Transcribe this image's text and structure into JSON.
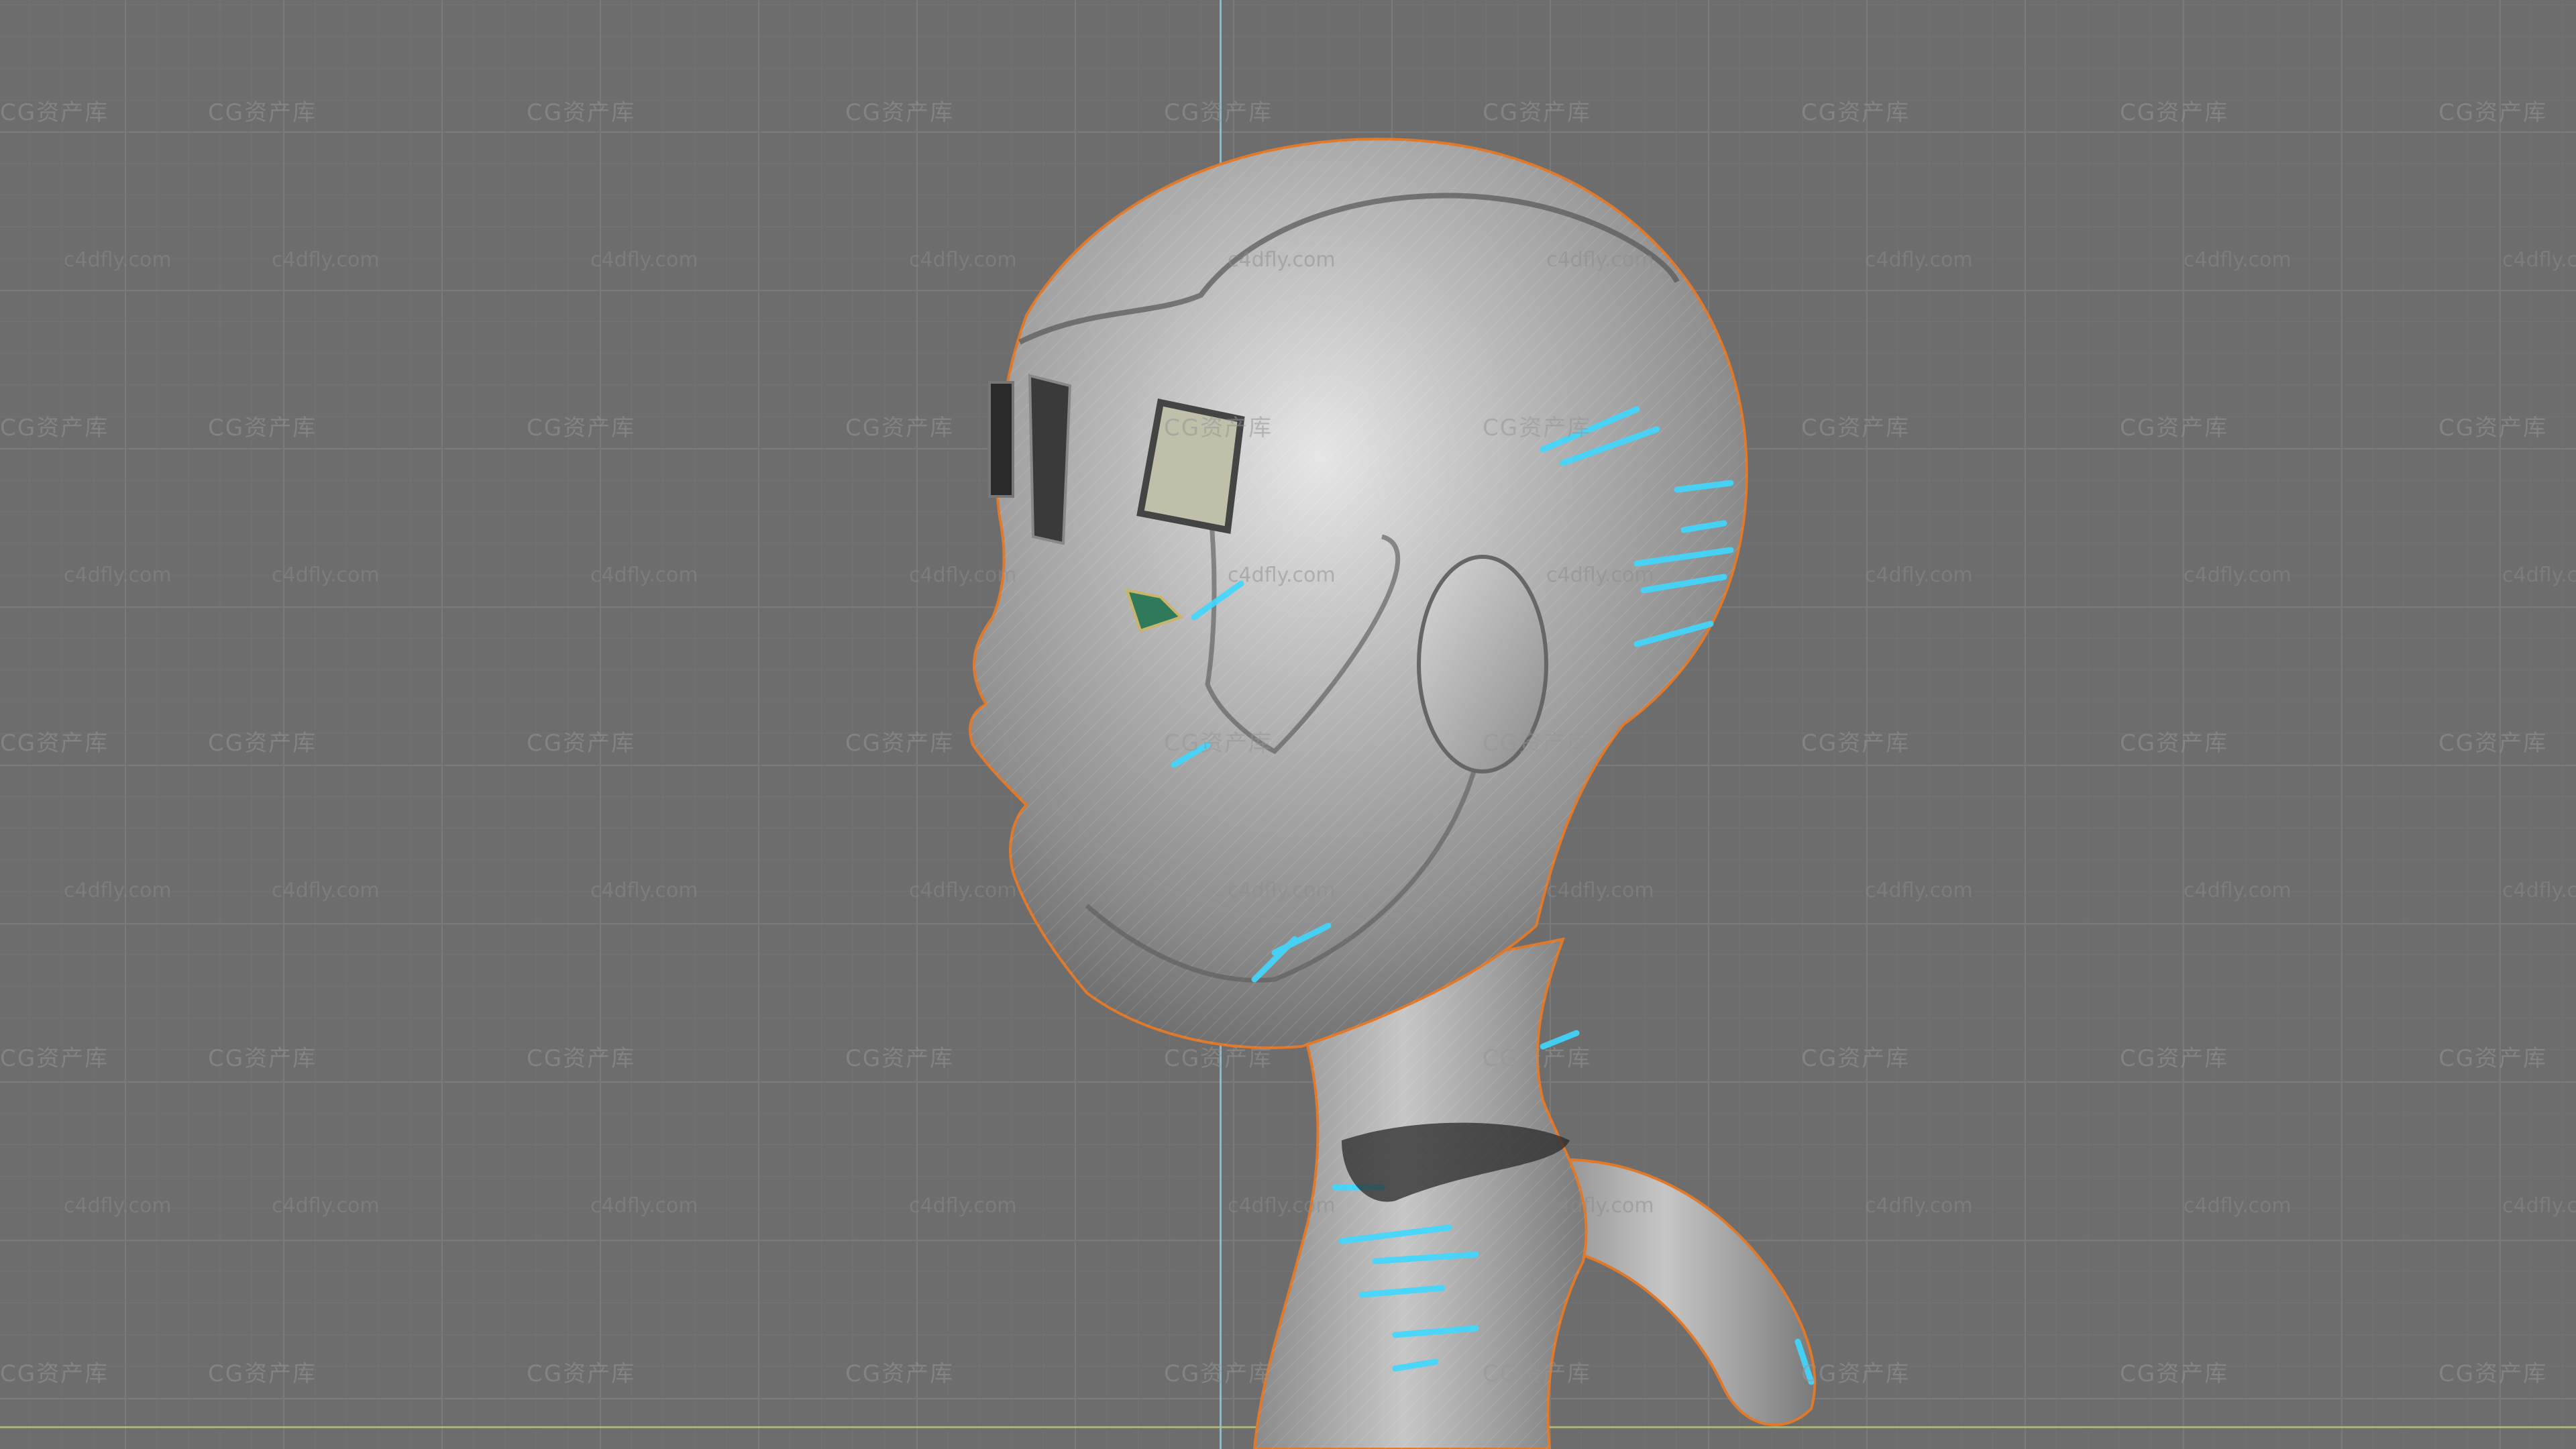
{
  "viewport": {
    "background_color": "#6d6d6d",
    "grid_color": "#7a7a7a",
    "axis_y_color": "#9ec3d6",
    "axis_x_color": "#b9c17a",
    "selection_outline_color": "#e07a2a"
  },
  "model": {
    "material_color": "#a9a9a9",
    "glow_color": "#3fd8ff",
    "icon": "robot-head-bust"
  },
  "watermark": {
    "logo_text": "CG资产库",
    "site_text": "c4dfly.com"
  }
}
